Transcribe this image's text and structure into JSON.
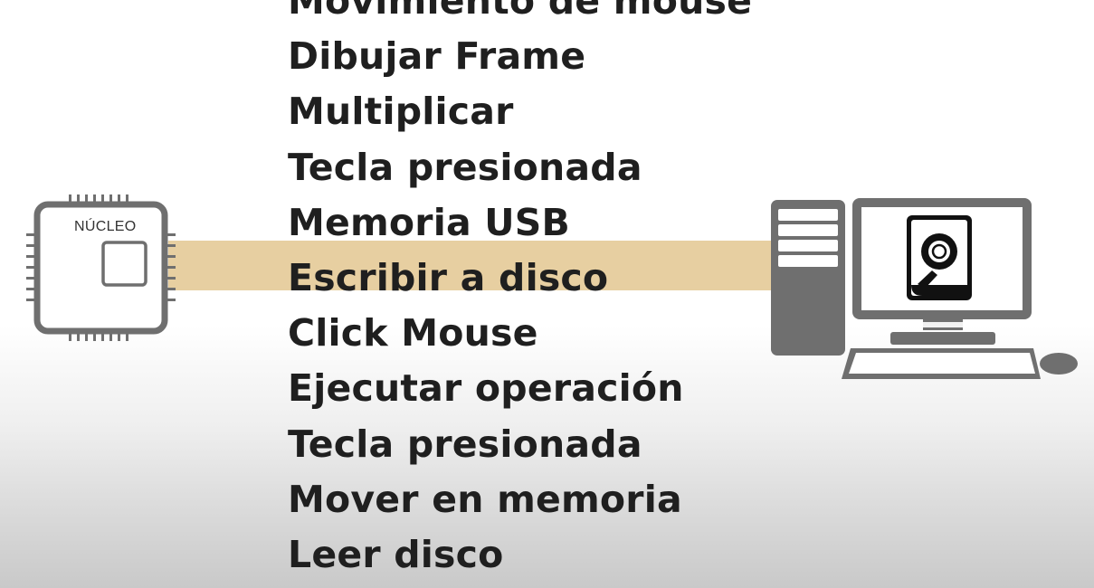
{
  "cpu": {
    "label": "NÚCLEO",
    "icon": "cpu-chip-icon",
    "color": "#6f6f6f"
  },
  "computer": {
    "icon": "desktop-computer-icon",
    "screen_icon": "hard-disk-icon",
    "color": "#6f6f6f"
  },
  "highlight": {
    "color": "#e7cfa1",
    "active_item": "Escribir a disco"
  },
  "events": [
    "Movimiento de mouse",
    "Dibujar Frame",
    "Multiplicar",
    "Tecla presionada",
    "Memoria USB",
    "Escribir a disco",
    "Click Mouse",
    "Ejecutar operación",
    "Tecla presionada",
    "Mover en memoria",
    "Leer disco"
  ]
}
